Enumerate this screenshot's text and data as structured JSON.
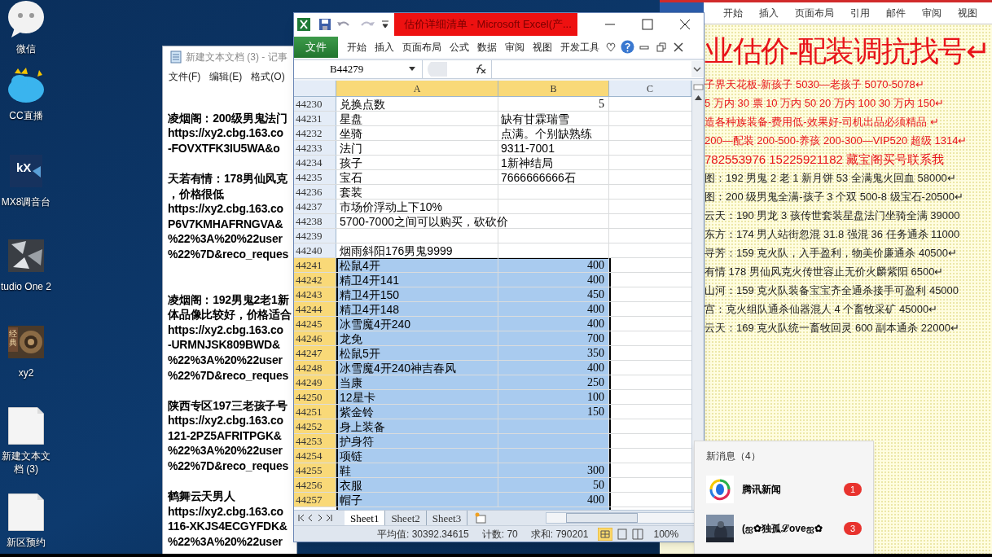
{
  "desktop_icons": [
    {
      "label": "微信",
      "kind": "chat"
    },
    {
      "label": "CC直播",
      "kind": "cloud"
    },
    {
      "label": "MX8调音台",
      "kind": "mixer",
      "icon_text": "kX"
    },
    {
      "label": "tudio One 2",
      "kind": "studio"
    },
    {
      "label": "xy2",
      "kind": "game",
      "icon_text": "经典"
    },
    {
      "label": "新建文本文档 (3)",
      "kind": "document"
    },
    {
      "label": "新区预约",
      "kind": "document"
    }
  ],
  "notepad": {
    "title": "新建文本文档 (3) - 记事",
    "menu": [
      "文件(F)",
      "编辑(E)",
      "格式(O)"
    ],
    "paragraphs": [
      {
        "lines": [
          "凌烟阁：200级男鬼法门",
          "https://xy2.cbg.163.co",
          "-FOVXTFK3IU5WA&o"
        ]
      },
      {
        "lines": [
          "天若有情：178男仙风克",
          "，价格很低",
          "https://xy2.cbg.163.co",
          "P6V7KMHAFRNGVA&",
          "%22%3A%20%22user",
          "%22%7D&reco_reques"
        ]
      },
      {
        "lines": [
          "凌烟阁：192男鬼2老1新",
          "体品像比较好，价格适合",
          "https://xy2.cbg.163.co",
          "-URMNJSK809BWD&",
          "%22%3A%20%22user",
          "%22%7D&reco_reques"
        ]
      },
      {
        "lines": [
          "陕西专区197三老孩子号",
          "https://xy2.cbg.163.co",
          "121-2PZ5AFRITPGK&",
          "%22%3A%20%22user",
          "%22%7D&reco_reques"
        ]
      },
      {
        "lines": [
          "鹤舞云天男人",
          "https://xy2.cbg.163.co",
          "116-XKJS4ECGYFDK&",
          "%22%3A%20%22user"
        ]
      }
    ]
  },
  "word": {
    "tabs": [
      {
        "label": "开始",
        "selected": false
      },
      {
        "label": "插入",
        "selected": false
      },
      {
        "label": "页面布局",
        "selected": false
      },
      {
        "label": "引用",
        "selected": false
      },
      {
        "label": "邮件",
        "selected": false
      },
      {
        "label": "审阅",
        "selected": false
      },
      {
        "label": "视图",
        "selected": false
      }
    ],
    "heading": "业估价-配装调抗找号↵",
    "lines": [
      {
        "text": "子界天花板-新孩子 5030—老孩子 5070-5078↵",
        "kind": "highlight"
      },
      {
        "text": "5 万内 30 票  10 万内 50  20 万内 100  30 万内 150↵",
        "kind": "highlight"
      },
      {
        "text": "造各种族装备-费用低-效果好-司机出品必须精品  ↵",
        "kind": "highlight"
      },
      {
        "text": "200—配装 200-500-养孩 200-300—VIP520 超级 1314↵",
        "kind": "highlight"
      },
      {
        "text": "782553976   15225921182  藏宝阁买号联系我",
        "kind": "contact"
      },
      {
        "text": "图：192 男鬼 2 老 1 新月饼 53 全满鬼火回血 58000↵",
        "kind": "normal"
      },
      {
        "text": "图：200 级男鬼全满-孩子 3 个双 500-8 级宝石-20500↵",
        "kind": "normal"
      },
      {
        "text": "云天：190 男龙 3 孩传世套装星盘法门坐骑全满 39000",
        "kind": "normal"
      },
      {
        "text": "东方：174 男人站街忽混 31.8 强混 36 任务通杀 11000",
        "kind": "normal"
      },
      {
        "text": "寻芳：159 克火队，入手盈利，物美价廉通杀 40500↵",
        "kind": "normal"
      },
      {
        "text": "有情 178 男仙风克火传世容止无价火麟紫阳 6500↵",
        "kind": "normal"
      },
      {
        "text": "山河：159 克火队装备宝宝齐全通杀接手可盈利 45000",
        "kind": "normal"
      },
      {
        "text": "宫：克火组队通杀仙器混人 4 个畜牧采矿 45000↵",
        "kind": "normal"
      },
      {
        "text": "云天：169 克火队统一畜牧回灵 600 副本通杀 22000↵",
        "kind": "normal"
      }
    ]
  },
  "excel": {
    "title": "估价详细清单 - Microsoft Excel(产...",
    "ribbon_tabs": [
      {
        "label": "文件",
        "kind": "file"
      },
      {
        "label": "开始",
        "kind": "tab"
      },
      {
        "label": "插入",
        "kind": "tab"
      },
      {
        "label": "页面布局",
        "kind": "tab"
      },
      {
        "label": "公式",
        "kind": "tab"
      },
      {
        "label": "数据",
        "kind": "tab"
      },
      {
        "label": "审阅",
        "kind": "tab"
      },
      {
        "label": "视图",
        "kind": "tab"
      },
      {
        "label": "开发工具",
        "kind": "tab"
      }
    ],
    "name_box": "B44279",
    "columns": [
      {
        "label": "A",
        "selected": true
      },
      {
        "label": "B",
        "selected": true
      },
      {
        "label": "C",
        "selected": false
      }
    ],
    "rows": [
      {
        "n": "44230",
        "a": "兑换点数",
        "b": "5",
        "kind": "number",
        "selected": false
      },
      {
        "n": "44231",
        "a": "星盘",
        "b": "缺有甘霖瑞雪",
        "kind": "text",
        "selected": false
      },
      {
        "n": "44232",
        "a": "坐骑",
        "b": "点满。个别缺熟练",
        "kind": "text",
        "selected": false
      },
      {
        "n": "44233",
        "a": "法门",
        "b": "9311-7001",
        "kind": "text",
        "selected": false
      },
      {
        "n": "44234",
        "a": "孩子",
        "b": "1新神结局",
        "kind": "text",
        "selected": false
      },
      {
        "n": "44235",
        "a": "宝石",
        "b": "7666666666石",
        "kind": "text",
        "selected": false
      },
      {
        "n": "44236",
        "a": "套装",
        "selected": false
      },
      {
        "n": "44237",
        "a": "市场价浮动上下10%",
        "selected": false
      },
      {
        "n": "44238",
        "a": "5700-7000之间可以购买，砍砍价",
        "selected": false
      },
      {
        "n": "44239",
        "selected": false
      },
      {
        "n": "44240",
        "a": "烟雨斜阳176男鬼9999",
        "selected": false
      },
      {
        "n": "44241",
        "a": "松鼠4开",
        "b": "400",
        "kind": "number",
        "selected": true
      },
      {
        "n": "44242",
        "a": "精卫4开141",
        "b": "400",
        "kind": "number",
        "selected": true
      },
      {
        "n": "44243",
        "a": "精卫4开150",
        "b": "450",
        "kind": "number",
        "selected": true
      },
      {
        "n": "44244",
        "a": "精卫4开148",
        "b": "400",
        "kind": "number",
        "selected": true
      },
      {
        "n": "44245",
        "a": "冰雪魔4开240",
        "b": "400",
        "kind": "number",
        "selected": true
      },
      {
        "n": "44246",
        "a": "龙免",
        "b": "700",
        "kind": "number",
        "selected": true
      },
      {
        "n": "44247",
        "a": "松鼠5开",
        "b": "350",
        "kind": "number",
        "selected": true
      },
      {
        "n": "44248",
        "a": "冰雪魔4开240神吉春风",
        "b": "400",
        "kind": "number",
        "selected": true
      },
      {
        "n": "44249",
        "a": "当康",
        "b": "250",
        "kind": "number",
        "selected": true
      },
      {
        "n": "44250",
        "a": "12星卡",
        "b": "100",
        "kind": "number",
        "selected": true
      },
      {
        "n": "44251",
        "a": "紫金铃",
        "b": "150",
        "kind": "number",
        "selected": true
      },
      {
        "n": "44252",
        "a": "身上装备",
        "selected": true
      },
      {
        "n": "44253",
        "a": "护身符",
        "selected": true
      },
      {
        "n": "44254",
        "a": "项链",
        "selected": true
      },
      {
        "n": "44255",
        "a": "鞋",
        "b": "300",
        "kind": "number",
        "selected": true
      },
      {
        "n": "44256",
        "a": "衣服",
        "b": "50",
        "kind": "number",
        "selected": true
      },
      {
        "n": "44257",
        "a": "帽子",
        "b": "400",
        "kind": "number",
        "selected": true
      }
    ],
    "sheets": [
      {
        "label": "Sheet1",
        "selected": true
      },
      {
        "label": "Sheet2",
        "selected": false
      },
      {
        "label": "Sheet3",
        "selected": false
      }
    ],
    "status": {
      "average": "平均值: 30392.34615",
      "count": "计数: 70",
      "sum": "求和: 790201",
      "zoom": "100%"
    }
  },
  "notifications": {
    "title": "新消息（4）",
    "items": [
      {
        "name": "腾讯新闻",
        "count": "1",
        "kind": "news"
      },
      {
        "name": "(ஐ✿独孤ℒoveஐ✿",
        "count": "3",
        "kind": "contact"
      }
    ]
  }
}
